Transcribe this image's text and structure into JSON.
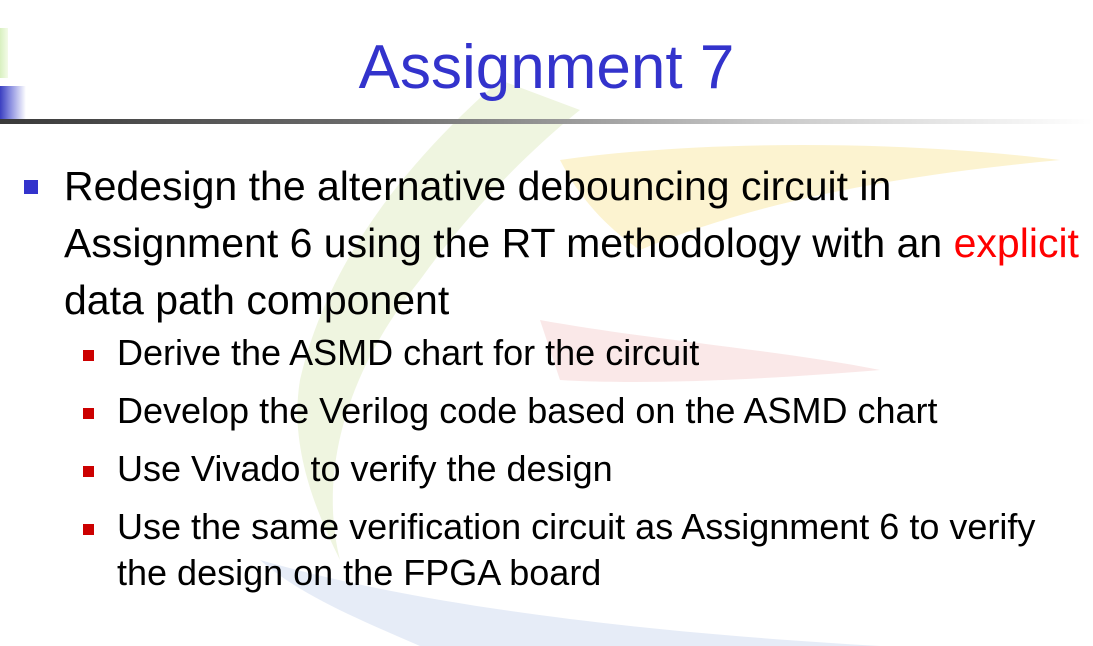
{
  "slide": {
    "title": "Assignment 7",
    "main_bullet": {
      "text_before": "Redesign the alternative debouncing circuit in Assignment 6 using the RT methodology with an",
      "highlight": "explicit",
      "text_after": "data path component"
    },
    "sub_bullets": [
      "Derive the ASMD chart for the circuit",
      "Develop the Verilog code based on the ASMD chart",
      "Use Vivado to verify the design",
      "Use the same verification circuit as Assignment 6 to verify the design on the FPGA board"
    ]
  },
  "colors": {
    "title": "#3333cc",
    "level1_bullet": "#3333cc",
    "level2_bullet": "#cc0000",
    "highlight": "#ff0000",
    "body_text": "#000000"
  }
}
